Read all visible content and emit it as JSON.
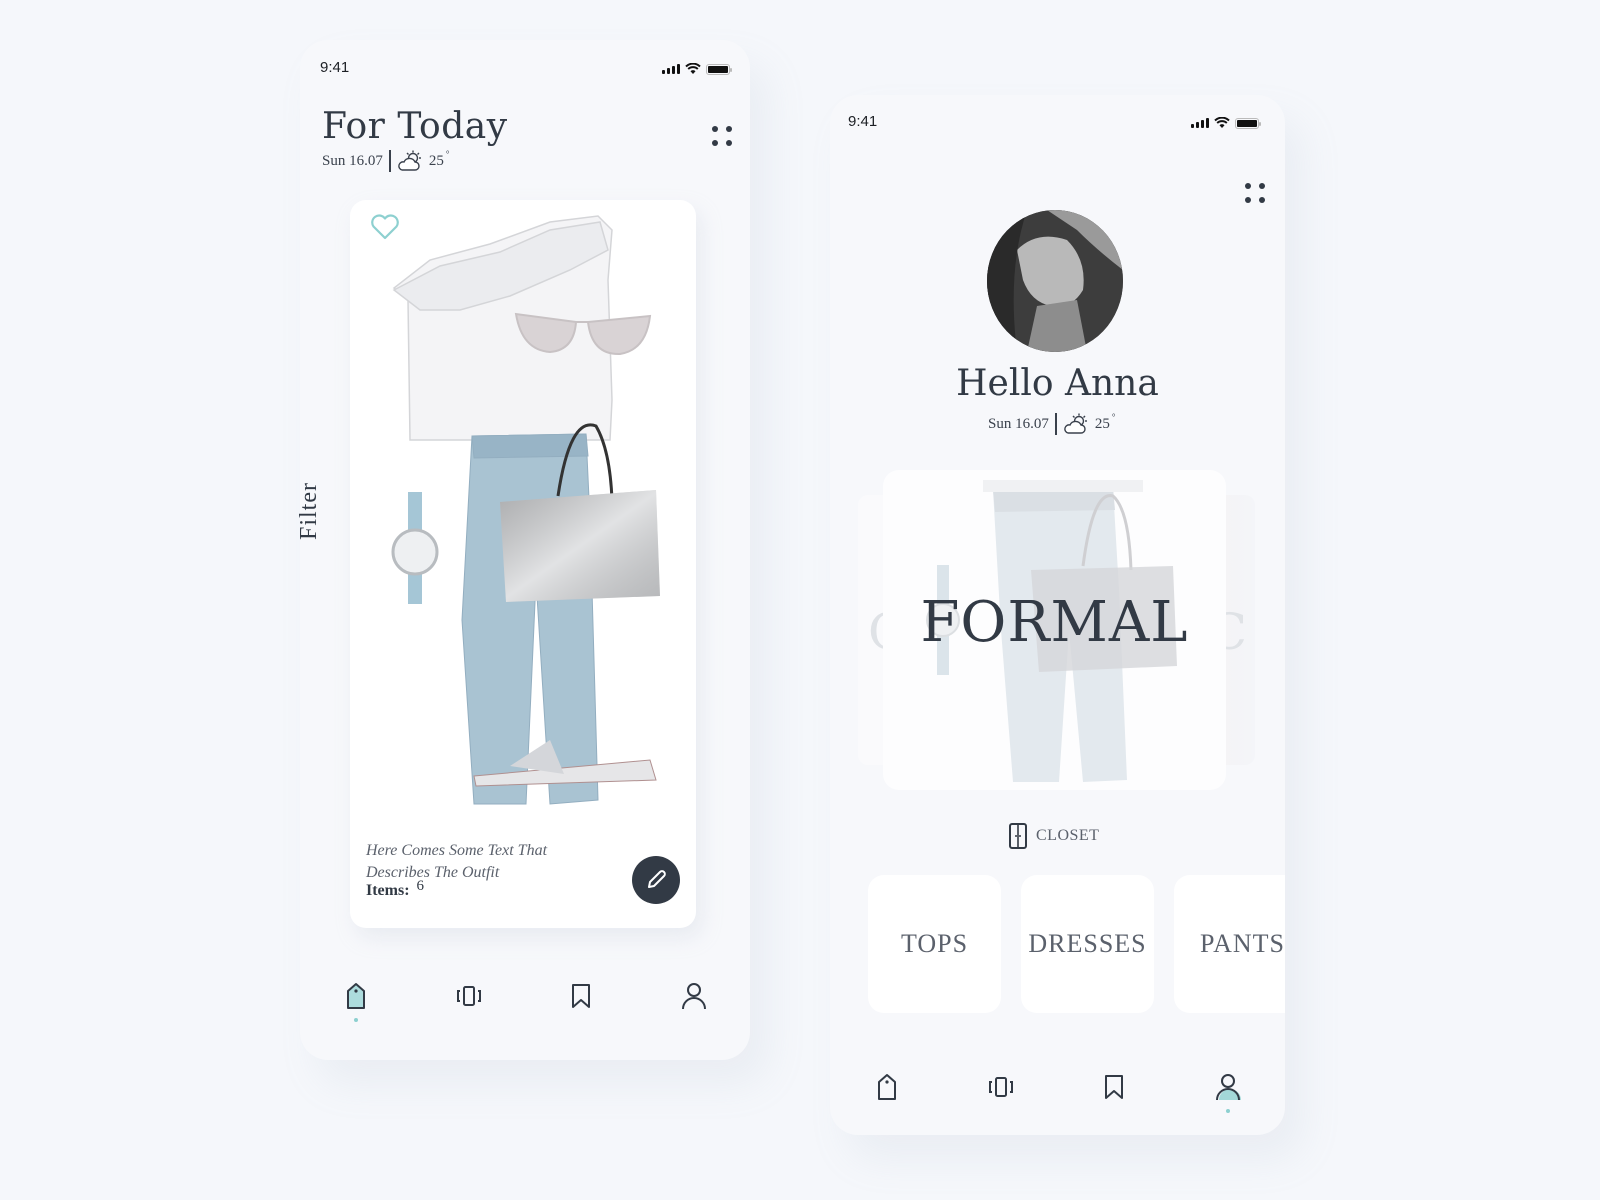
{
  "left_screen": {
    "status_bar": {
      "time": "9:41"
    },
    "header": {
      "title": "For Today",
      "date": "Sun 16.07",
      "temperature": "25",
      "degree_symbol": "°",
      "weather_icon": "partly-cloudy-icon"
    },
    "filter_label": "Filter",
    "outfit_card": {
      "favorite_icon": "heart-icon",
      "items_pictured": [
        "ruffle one-shoulder top",
        "sunglasses",
        "paperbag-waist jeans",
        "wristwatch",
        "metallic tote bag",
        "slide sandals"
      ],
      "description": "Here Comes Some Text That Describes The Outfit",
      "items_label": "Items:",
      "items_count": "6",
      "edit_icon": "pencil-icon"
    },
    "tab_bar": [
      {
        "name": "tag",
        "icon": "tag-icon",
        "active": true
      },
      {
        "name": "outfits",
        "icon": "carousel-icon",
        "active": false
      },
      {
        "name": "saved",
        "icon": "bookmark-icon",
        "active": false
      },
      {
        "name": "profile",
        "icon": "user-icon",
        "active": false
      }
    ]
  },
  "right_screen": {
    "status_bar": {
      "time": "9:41"
    },
    "greeting": "Hello Anna",
    "date": "Sun 16.07",
    "temperature": "25",
    "degree_symbol": "°",
    "carousel": {
      "current": "FORMAL",
      "prev_partial": "CA",
      "next_partial": "IC"
    },
    "closet_label": "CLOSET",
    "categories": [
      "TOPS",
      "DRESSES",
      "PANTS"
    ],
    "tab_bar": [
      {
        "name": "tag",
        "icon": "tag-icon",
        "active": false
      },
      {
        "name": "outfits",
        "icon": "carousel-icon",
        "active": false
      },
      {
        "name": "saved",
        "icon": "bookmark-icon",
        "active": false
      },
      {
        "name": "profile",
        "icon": "user-icon",
        "active": true
      }
    ]
  },
  "colors": {
    "accent": "#8dd0d0",
    "ink": "#323a45",
    "background": "#f5f7fb"
  }
}
